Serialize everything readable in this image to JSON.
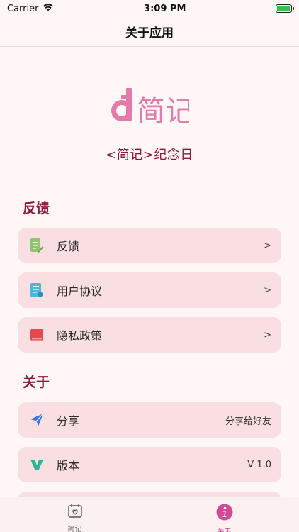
{
  "status": {
    "carrier": "Carrier",
    "time": "3:09 PM"
  },
  "nav": {
    "title": "关于应用"
  },
  "logo": {
    "subtitle": "<简记>纪念日",
    "wordmark": "简记"
  },
  "sections": {
    "feedback": {
      "title": "反馈"
    },
    "about": {
      "title": "关于"
    }
  },
  "rows": {
    "feedback": {
      "label": "反馈",
      "chevron": ">"
    },
    "agreement": {
      "label": "用户协议",
      "chevron": ">"
    },
    "privacy": {
      "label": "隐私政策",
      "chevron": ">"
    },
    "share": {
      "label": "分享",
      "value": "分享给好友"
    },
    "version": {
      "label": "版本",
      "value": "V 1.0"
    }
  },
  "tabs": [
    {
      "label": "简记",
      "icon": "calendar-heart-icon",
      "active": false
    },
    {
      "label": "关于",
      "icon": "info-icon",
      "active": true
    }
  ],
  "colors": {
    "accent": "#8b1a3a",
    "brand_pink": "#e27aaa",
    "row_bg": "#f9dfe1",
    "tab_active": "#d04b96"
  }
}
